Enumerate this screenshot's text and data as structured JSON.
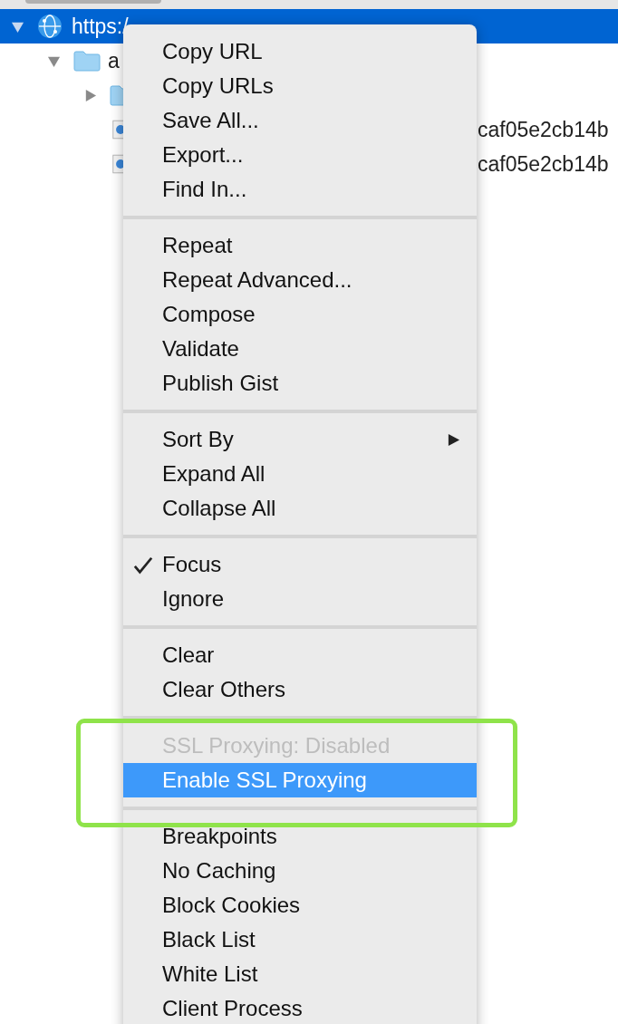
{
  "tree": [
    {
      "label": "https:/",
      "selected": true,
      "expanded": true,
      "kind": "host"
    },
    {
      "label": "a",
      "selected": false,
      "expanded": true,
      "kind": "folder"
    },
    {
      "selected": false,
      "expanded": false,
      "kind": "folder"
    },
    {
      "label": "caf05e2cb14b",
      "selected": false,
      "kind": "file"
    },
    {
      "label": "caf05e2cb14b",
      "selected": false,
      "kind": "file"
    }
  ],
  "menu": {
    "groups": [
      [
        {
          "label": "Copy URL",
          "checked": false,
          "disabled": false,
          "selected": false,
          "submenu": false
        },
        {
          "label": "Copy URLs",
          "checked": false,
          "disabled": false,
          "selected": false,
          "submenu": false
        },
        {
          "label": "Save All...",
          "checked": false,
          "disabled": false,
          "selected": false,
          "submenu": false
        },
        {
          "label": "Export...",
          "checked": false,
          "disabled": false,
          "selected": false,
          "submenu": false
        },
        {
          "label": "Find In...",
          "checked": false,
          "disabled": false,
          "selected": false,
          "submenu": false
        }
      ],
      [
        {
          "label": "Repeat",
          "checked": false,
          "disabled": false,
          "selected": false,
          "submenu": false
        },
        {
          "label": "Repeat Advanced...",
          "checked": false,
          "disabled": false,
          "selected": false,
          "submenu": false
        },
        {
          "label": "Compose",
          "checked": false,
          "disabled": false,
          "selected": false,
          "submenu": false
        },
        {
          "label": "Validate",
          "checked": false,
          "disabled": false,
          "selected": false,
          "submenu": false
        },
        {
          "label": "Publish Gist",
          "checked": false,
          "disabled": false,
          "selected": false,
          "submenu": false
        }
      ],
      [
        {
          "label": "Sort By",
          "checked": false,
          "disabled": false,
          "selected": false,
          "submenu": true
        },
        {
          "label": "Expand All",
          "checked": false,
          "disabled": false,
          "selected": false,
          "submenu": false
        },
        {
          "label": "Collapse All",
          "checked": false,
          "disabled": false,
          "selected": false,
          "submenu": false
        }
      ],
      [
        {
          "label": "Focus",
          "checked": true,
          "disabled": false,
          "selected": false,
          "submenu": false
        },
        {
          "label": "Ignore",
          "checked": false,
          "disabled": false,
          "selected": false,
          "submenu": false
        }
      ],
      [
        {
          "label": "Clear",
          "checked": false,
          "disabled": false,
          "selected": false,
          "submenu": false
        },
        {
          "label": "Clear Others",
          "checked": false,
          "disabled": false,
          "selected": false,
          "submenu": false
        }
      ],
      [
        {
          "label": "SSL Proxying: Disabled",
          "checked": false,
          "disabled": true,
          "selected": false,
          "submenu": false
        },
        {
          "label": "Enable SSL Proxying",
          "checked": false,
          "disabled": false,
          "selected": true,
          "submenu": false
        }
      ],
      [
        {
          "label": "Breakpoints",
          "checked": false,
          "disabled": false,
          "selected": false,
          "submenu": false
        },
        {
          "label": "No Caching",
          "checked": false,
          "disabled": false,
          "selected": false,
          "submenu": false
        },
        {
          "label": "Block Cookies",
          "checked": false,
          "disabled": false,
          "selected": false,
          "submenu": false
        },
        {
          "label": "Black List",
          "checked": false,
          "disabled": false,
          "selected": false,
          "submenu": false
        },
        {
          "label": "White List",
          "checked": false,
          "disabled": false,
          "selected": false,
          "submenu": false
        },
        {
          "label": "Client Process",
          "checked": false,
          "disabled": false,
          "selected": false,
          "submenu": false
        }
      ]
    ]
  }
}
